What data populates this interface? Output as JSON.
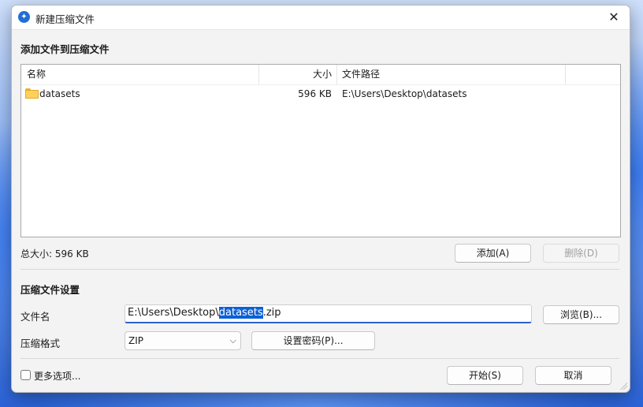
{
  "window": {
    "title": "新建压缩文件",
    "close_glyph": "✕"
  },
  "add_section": {
    "heading": "添加文件到压缩文件",
    "columns": [
      "名称",
      "大小",
      "文件路径"
    ],
    "rows": [
      {
        "icon": "folder-icon",
        "name": "datasets",
        "size": "596 KB",
        "path": "E:\\Users\\Desktop\\datasets"
      }
    ],
    "total_size": "总大小: 596 KB",
    "add_button": "添加(A)",
    "delete_button": "删除(D)"
  },
  "settings": {
    "heading": "压缩文件设置",
    "filename_label": "文件名",
    "filename_prefix": "E:\\Users\\Desktop\\",
    "filename_selected": "datasets",
    "filename_suffix": ".zip",
    "browse_button": "浏览(B)...",
    "format_label": "压缩格式",
    "format_value": "ZIP",
    "password_button": "设置密码(P)..."
  },
  "footer": {
    "more_options": "更多选项...",
    "more_options_checked": false,
    "start_button": "开始(S)",
    "cancel_button": "取消"
  },
  "colors": {
    "accent": "#0b61d6",
    "input_focus": "#2d62c9"
  }
}
